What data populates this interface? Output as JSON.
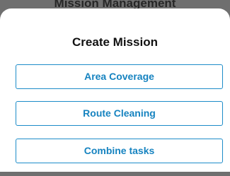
{
  "backdrop": {
    "title": "Mission Management"
  },
  "dialog": {
    "title": "Create Mission",
    "options": [
      {
        "label": "Area Coverage"
      },
      {
        "label": "Route Cleaning"
      },
      {
        "label": "Combine tasks"
      }
    ]
  },
  "colors": {
    "accent": "#1d8cc9",
    "backdrop": "#6f6f6f",
    "sheet": "#ffffff"
  }
}
